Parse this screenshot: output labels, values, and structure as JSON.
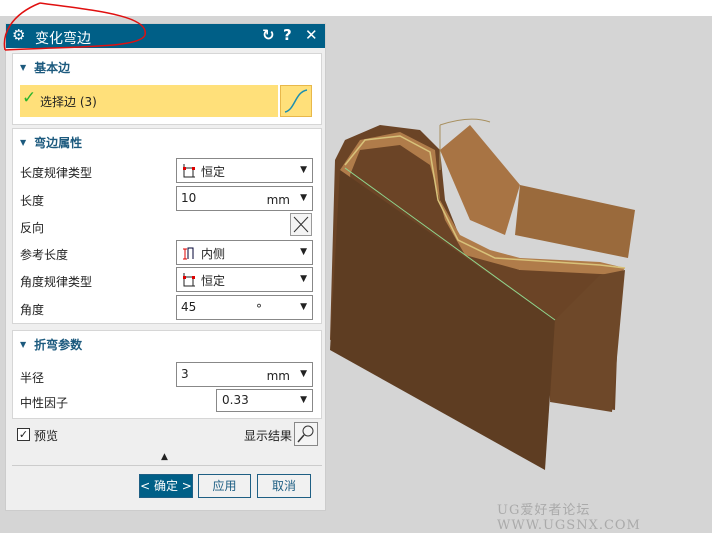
{
  "dialog": {
    "title": "变化弯边",
    "icons": [
      "gear-icon",
      "reset-icon",
      "help-icon",
      "close-icon"
    ]
  },
  "section_base": {
    "title": "基本边",
    "select_label": "选择边 (3)"
  },
  "section_flange": {
    "title": "弯边属性",
    "length_law_label": "长度规律类型",
    "length_law_value": "恒定",
    "length_label": "长度",
    "length_value": "10",
    "length_unit": "mm",
    "reverse_label": "反向",
    "ref_length_label": "参考长度",
    "ref_length_value": "内侧",
    "angle_law_label": "角度规律类型",
    "angle_law_value": "恒定",
    "angle_label": "角度",
    "angle_value": "45",
    "angle_unit": "°"
  },
  "section_bend": {
    "title": "折弯参数",
    "radius_label": "半径",
    "radius_value": "3",
    "radius_unit": "mm",
    "neutral_label": "中性因子",
    "neutral_value": "0.33"
  },
  "preview": {
    "label": "预览",
    "checked": true,
    "show_result": "显示结果"
  },
  "buttons": {
    "ok": "< 确定 >",
    "apply": "应用",
    "cancel": "取消"
  },
  "watermark": "UG爱好者论坛 WWW.UGSNX.COM",
  "colors": {
    "title_bar": "#005f87",
    "selection": "#ffe07a",
    "model": "#8a5a32"
  }
}
